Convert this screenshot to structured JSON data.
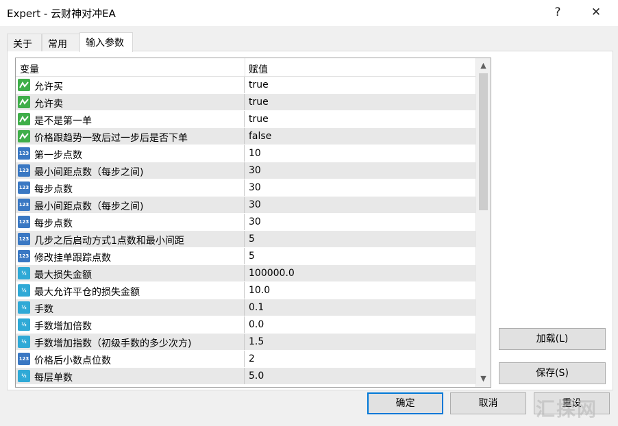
{
  "window": {
    "title": "Expert - 云财神对冲EA",
    "help_label": "?",
    "close_label": "✕"
  },
  "tabs": [
    {
      "label": "关于"
    },
    {
      "label": "常用"
    },
    {
      "label": "输入参数"
    }
  ],
  "grid": {
    "col_variable": "变量",
    "col_value": "赋值",
    "rows": [
      {
        "type": "bool",
        "name": "允许买",
        "value": "true"
      },
      {
        "type": "bool",
        "name": "允许卖",
        "value": "true"
      },
      {
        "type": "bool",
        "name": "是不是第一单",
        "value": "true"
      },
      {
        "type": "bool",
        "name": "价格跟趋势一致后过一步后是否下单",
        "value": "false"
      },
      {
        "type": "int",
        "name": "第一步点数",
        "value": "10"
      },
      {
        "type": "int",
        "name": "最小间距点数（每步之间)",
        "value": "30"
      },
      {
        "type": "int",
        "name": "每步点数",
        "value": "30"
      },
      {
        "type": "int",
        "name": "最小间距点数（每步之间)",
        "value": "30"
      },
      {
        "type": "int",
        "name": "每步点数",
        "value": "30"
      },
      {
        "type": "int",
        "name": "几步之后启动方式1点数和最小间距",
        "value": "5"
      },
      {
        "type": "int",
        "name": "修改挂单跟踪点数",
        "value": "5"
      },
      {
        "type": "double",
        "name": "最大损失金额",
        "value": "100000.0"
      },
      {
        "type": "double",
        "name": "最大允许平仓的损失金额",
        "value": "10.0"
      },
      {
        "type": "double",
        "name": "手数",
        "value": "0.1"
      },
      {
        "type": "double",
        "name": "手数增加倍数",
        "value": "0.0"
      },
      {
        "type": "double",
        "name": "手数增加指数（初级手数的多少次方)",
        "value": "1.5"
      },
      {
        "type": "int",
        "name": "价格后小数点位数",
        "value": "2"
      },
      {
        "type": "double",
        "name": "每层单数",
        "value": "5.0"
      }
    ],
    "icon_text": {
      "int": "123",
      "double": "½"
    }
  },
  "buttons": {
    "load": "加载(L)",
    "save": "保存(S)",
    "ok": "确定",
    "cancel": "取消",
    "reset": "重设"
  },
  "watermark": "汇探网"
}
